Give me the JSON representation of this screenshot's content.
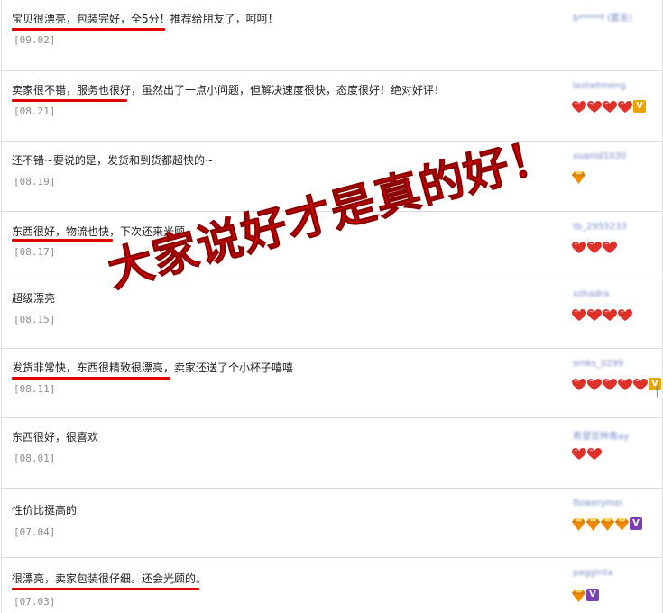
{
  "overlay_text": "大家说好才是真的好！",
  "reviews": [
    {
      "comment": "宝贝很漂亮，包装完好，全5分！推荐给朋友了，呵呵！",
      "date": "[09.02]",
      "user": "b*****f (匿名)",
      "badges": []
    },
    {
      "comment": "卖家很不错，服务也很好，虽然出了一点小问题，但解决速度很快，态度很好！绝对好评！",
      "date": "[08.21]",
      "user": "lastwtmeng",
      "badges": [
        "heart",
        "heart",
        "heart",
        "heart",
        "vip-gold"
      ]
    },
    {
      "comment": "还不错~要说的是，发货和到货都超快的~",
      "date": "[08.19]",
      "user": "xuanid1030",
      "badges": [
        "diamond"
      ]
    },
    {
      "comment": "东西很好，物流也快，下次还来光顾",
      "date": "[08.17]",
      "user": "tb_2955233",
      "badges": [
        "heart",
        "heart",
        "heart"
      ]
    },
    {
      "comment": "超级漂亮",
      "date": "[08.15]",
      "user": "xzhadra",
      "badges": [
        "heart",
        "heart",
        "heart",
        "heart"
      ]
    },
    {
      "comment": "发货非常快，东西很精致很漂亮，卖家还送了个小杯子嘻嘻",
      "date": "[08.11]",
      "user": "smks_0299",
      "badges": [
        "heart",
        "heart",
        "heart",
        "heart",
        "heart",
        "vip-gold"
      ]
    },
    {
      "comment": "东西很好，很喜欢",
      "date": "[08.01]",
      "user": "希望豆种角ay",
      "badges": [
        "heart",
        "heart"
      ]
    },
    {
      "comment": "性价比挺高的",
      "date": "[07.04]",
      "user": "flowerymei",
      "badges": [
        "diamond",
        "diamond",
        "diamond",
        "diamond",
        "vip-purple"
      ]
    },
    {
      "comment": "很漂亮，卖家包装很仔细。还会光顾的。",
      "date": "[07.03]",
      "user": "pagginta",
      "badges": [
        "diamond",
        "vip-purple"
      ]
    }
  ],
  "colors": {
    "underline": "#e00000",
    "heart": "#e0302a",
    "diamond": "#f08a00",
    "date": "#8c8c8c"
  }
}
